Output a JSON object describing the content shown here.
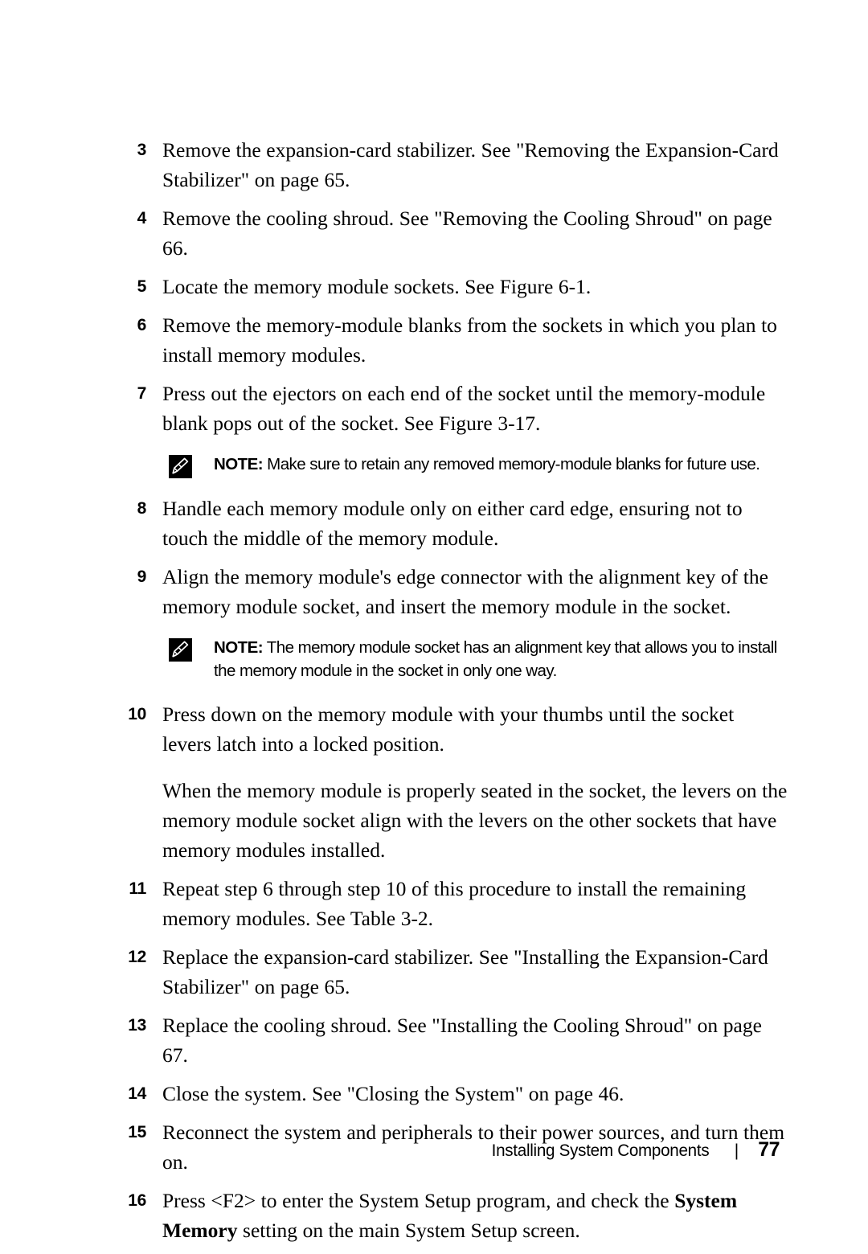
{
  "document": {
    "type": "manual-page",
    "page_number": "77",
    "footer": {
      "section_title": "Installing System Components",
      "separator": "|",
      "page_number": "77"
    }
  },
  "steps": [
    {
      "number": "3",
      "text": "Remove the expansion-card stabilizer. See \"Removing the Expansion-Card Stabilizer\" on page 65."
    },
    {
      "number": "4",
      "text": "Remove the cooling shroud. See \"Removing the Cooling Shroud\" on page 66."
    },
    {
      "number": "5",
      "text": "Locate the memory module sockets. See Figure 6-1."
    },
    {
      "number": "6",
      "text": "Remove the memory-module blanks from the sockets in which you plan to install memory modules."
    },
    {
      "number": "7",
      "text": "Press out the ejectors on each end of the socket until the memory-module blank pops out of the socket. See Figure 3-17."
    },
    {
      "number": "8",
      "text": "Handle each memory module only on either card edge, ensuring not to touch the middle of the memory module."
    },
    {
      "number": "9",
      "text": "Align the memory module's edge connector with the alignment key of the memory module socket, and insert the memory module in the socket."
    },
    {
      "number": "10",
      "text": "Press down on the memory module with your thumbs until the socket levers latch into a locked position.",
      "continuation": "When the memory module is properly seated in the socket, the levers on the memory module socket align with the levers on the other sockets that have memory modules installed."
    },
    {
      "number": "11",
      "text": "Repeat step 6 through step 10 of this procedure to install the remaining memory modules. See Table 3-2."
    },
    {
      "number": "12",
      "text": "Replace the expansion-card stabilizer. See \"Installing the Expansion-Card Stabilizer\" on page 65."
    },
    {
      "number": "13",
      "text": "Replace the cooling shroud. See \"Installing the Cooling Shroud\" on page 67."
    },
    {
      "number": "14",
      "text": "Close the system. See \"Closing the System\" on page 46."
    },
    {
      "number": "15",
      "text": "Reconnect the system and peripherals to their power sources, and turn them on."
    },
    {
      "number": "16",
      "text_before_bold": "Press <F2> to enter the System Setup program, and check the ",
      "bold_text": "System Memory",
      "text_after_bold": " setting on the main System Setup screen."
    }
  ],
  "notes": [
    {
      "icon": "pencil-note-icon",
      "label": "NOTE:",
      "text": " Make sure to retain any removed memory-module blanks for future use."
    },
    {
      "icon": "pencil-note-icon",
      "label": "NOTE:",
      "text": " The memory module socket has an alignment key that allows you to install the memory module in the socket in only one way."
    }
  ],
  "colors": {
    "page_background": "#ffffff",
    "text": "#000000",
    "note_icon_background": "#000000",
    "note_icon_glyph": "#ffffff"
  }
}
